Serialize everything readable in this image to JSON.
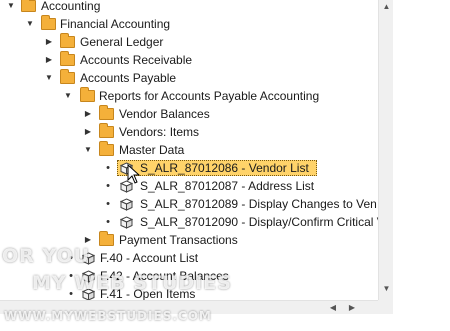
{
  "tree": {
    "accounting": "Accounting",
    "financial_accounting": "Financial Accounting",
    "general_ledger": "General Ledger",
    "accounts_receivable": "Accounts Receivable",
    "accounts_payable": "Accounts Payable",
    "reports_ap": "Reports for Accounts Payable Accounting",
    "vendor_balances": "Vendor Balances",
    "vendors_items": "Vendors: Items",
    "master_data": "Master Data",
    "reports": [
      "S_ALR_87012086 - Vendor List",
      "S_ALR_87012087 - Address List",
      "S_ALR_87012089 - Display Changes to Ven",
      "S_ALR_87012090 - Display/Confirm Critical V"
    ],
    "payment_transactions": "Payment Transactions",
    "f40": "F.40 - Account List",
    "f42": "F.42 - Account Balances",
    "f41": "F.41 - Open Items"
  },
  "watermark": {
    "line1": "OR YOU",
    "line2": "MY WEB STUDIES",
    "url": "WWW.MYWEBSTUDIES.COM"
  },
  "icons": {
    "folder": "folder-icon",
    "report": "report-cube-icon",
    "expanded": "triangle-down-icon",
    "collapsed": "triangle-right-icon"
  },
  "colors": {
    "folder": "#f4b03a",
    "selection": "#ffd36a"
  }
}
